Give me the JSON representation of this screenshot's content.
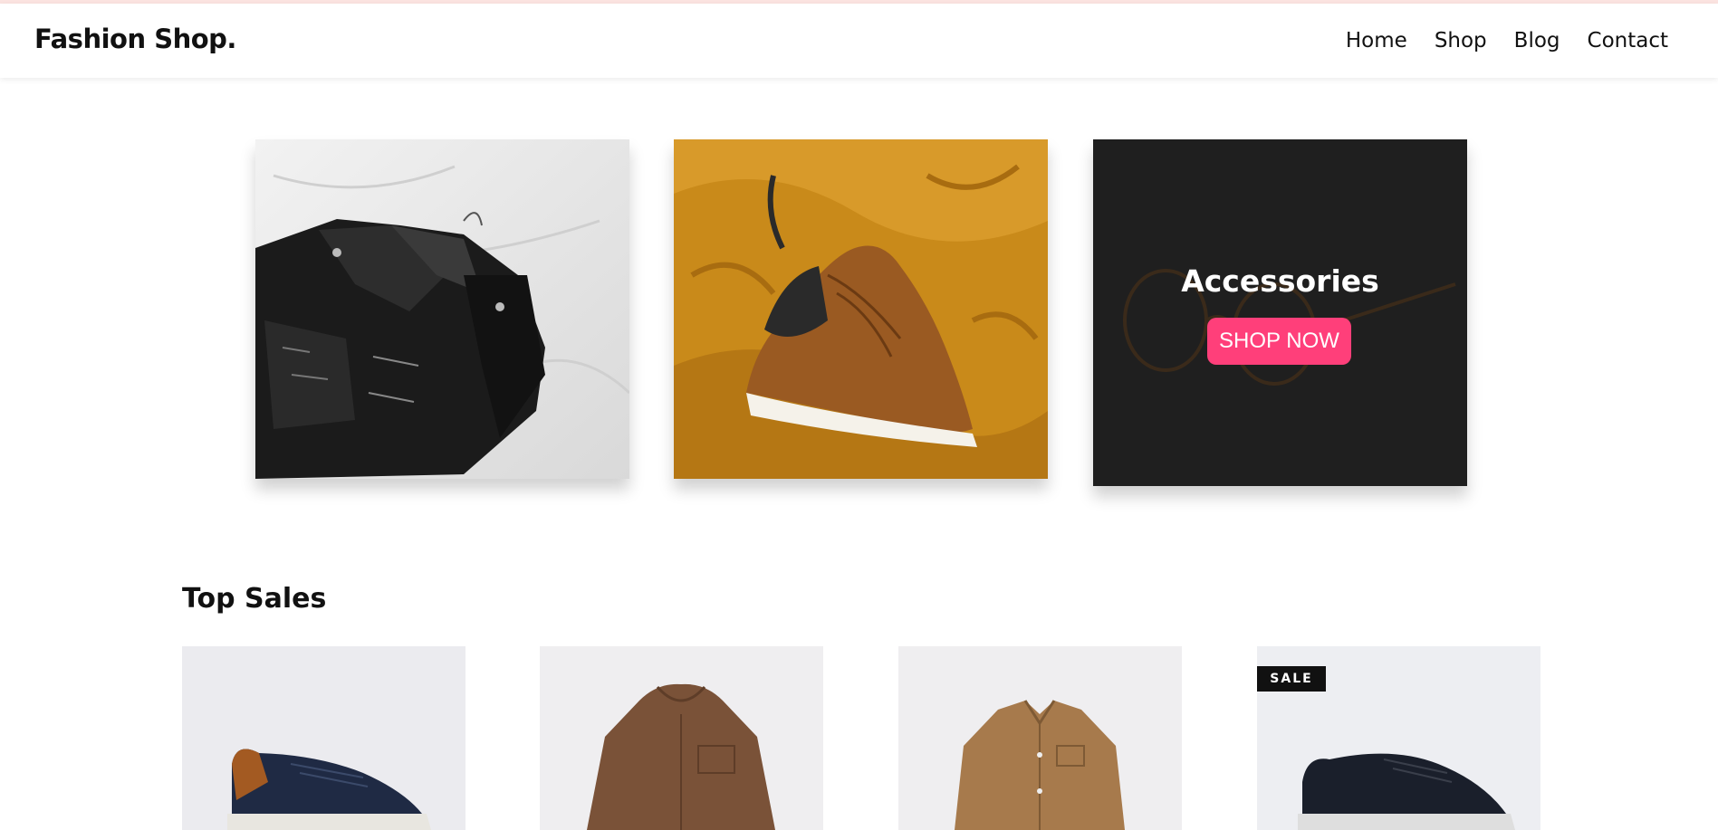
{
  "header": {
    "logo": "Fashion Shop.",
    "nav": [
      "Home",
      "Shop",
      "Blog",
      "Contact"
    ]
  },
  "categories": [
    {
      "image": "black leather jacket on white sheet"
    },
    {
      "image": "brown sneaker on mustard fabric"
    },
    {
      "title": "Accessories",
      "button": "SHOP NOW",
      "image": "sunglasses on dark background"
    }
  ],
  "top_sales": {
    "title": "Top Sales",
    "products": [
      {
        "image": "navy and brown sneaker"
      },
      {
        "image": "brown hooded jacket"
      },
      {
        "image": "tan button shirt jacket"
      },
      {
        "image": "black sneaker",
        "badge": "SALE"
      }
    ]
  },
  "colors": {
    "accent": "#ff3f7a",
    "header_line": "#fbe3e0",
    "dark_card": "#1f1f1f"
  }
}
